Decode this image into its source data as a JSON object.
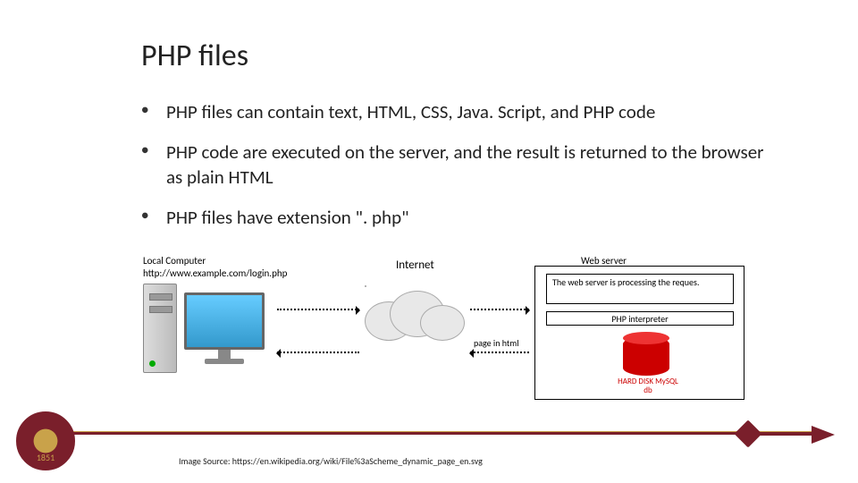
{
  "title": "PHP files",
  "bullets": [
    "PHP files can contain text, HTML, CSS, Java. Script, and PHP code",
    "PHP code are executed on the server, and the result is returned to the browser as plain HTML",
    "PHP files have extension \". php\""
  ],
  "diagram": {
    "local_title": "Local Computer",
    "local_url": "http://www.example.com/login.php",
    "internet": "Internet",
    "webserver": "Web server",
    "processing": "The web server is processing the reques.",
    "php_interp": "PHP interpreter",
    "disk_label": "HARD DISK MySQL db",
    "page_in_html": "page in html"
  },
  "footer": {
    "seal_year": "1851",
    "credit": "Image Source: https://en.wikipedia.org/wiki/File%3aScheme_dynamic_page_en.svg"
  }
}
